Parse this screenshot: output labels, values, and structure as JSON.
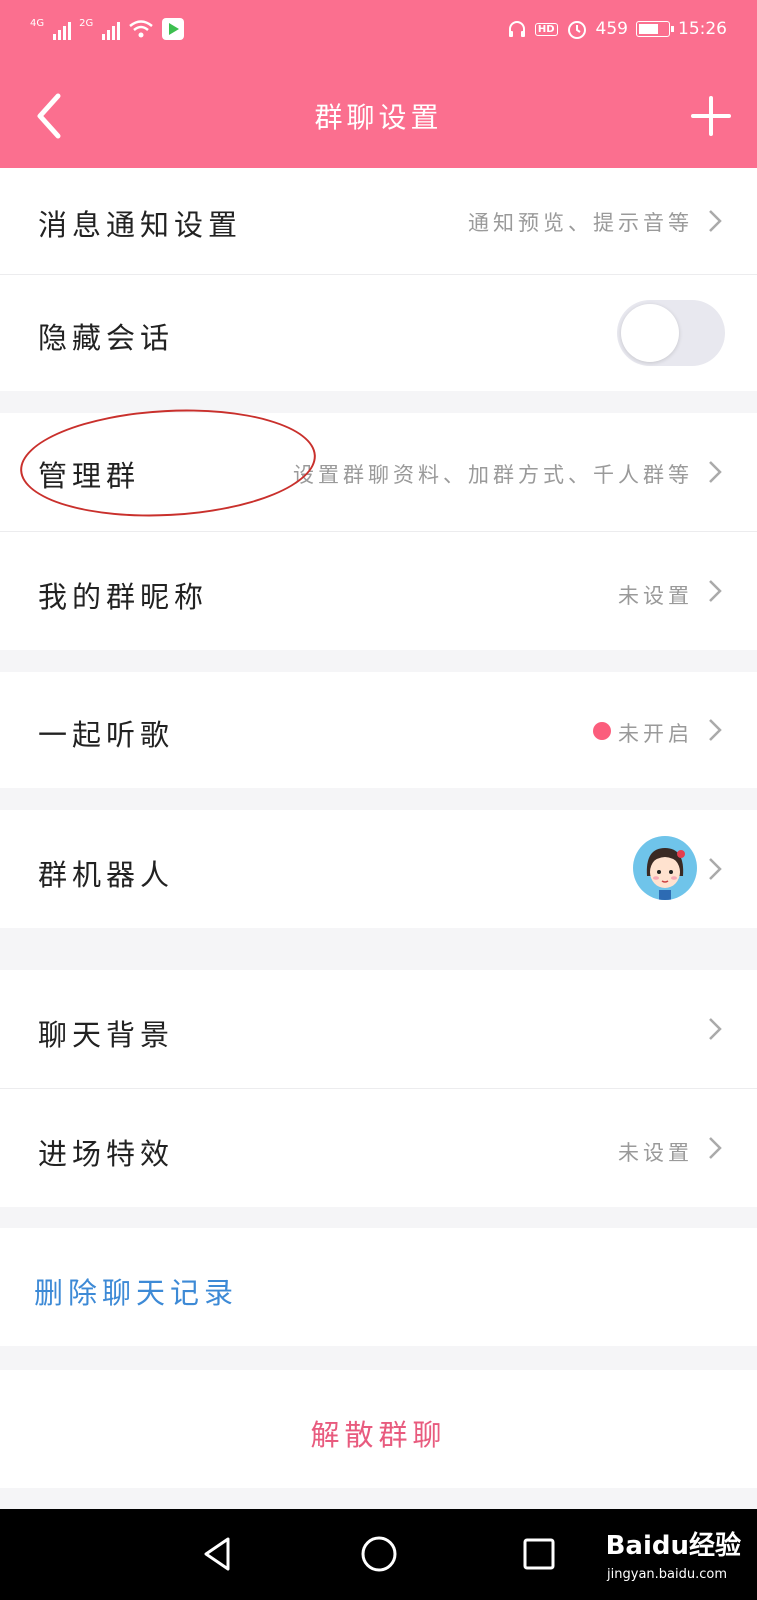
{
  "status_bar": {
    "network1": "4G",
    "network2": "2G",
    "hd_label": "HD",
    "speed": "459",
    "time": "15:26"
  },
  "header": {
    "title": "群聊设置"
  },
  "settings": {
    "notifications": {
      "label": "消息通知设置",
      "value": "通知预览、提示音等"
    },
    "hide_chat": {
      "label": "隐藏会话",
      "toggle_on": false
    },
    "manage_group": {
      "label": "管理群",
      "value": "设置群聊资料、加群方式、千人群等"
    },
    "my_nickname": {
      "label": "我的群昵称",
      "value": "未设置"
    },
    "listen_together": {
      "label": "一起听歌",
      "value": "未开启"
    },
    "group_robot": {
      "label": "群机器人"
    },
    "chat_background": {
      "label": "聊天背景"
    },
    "entry_effect": {
      "label": "进场特效",
      "value": "未设置"
    },
    "delete_history": {
      "label": "删除聊天记录"
    },
    "dissolve": {
      "label": "解散群聊"
    }
  },
  "watermark": {
    "brand": "Baidu经验",
    "url": "jingyan.baidu.com"
  },
  "colors": {
    "header": "#fb6f8f",
    "dot": "#fb5d7c",
    "delete": "#3d8ad6",
    "dissolve": "#e85b7e",
    "annotation": "#c9302c"
  }
}
